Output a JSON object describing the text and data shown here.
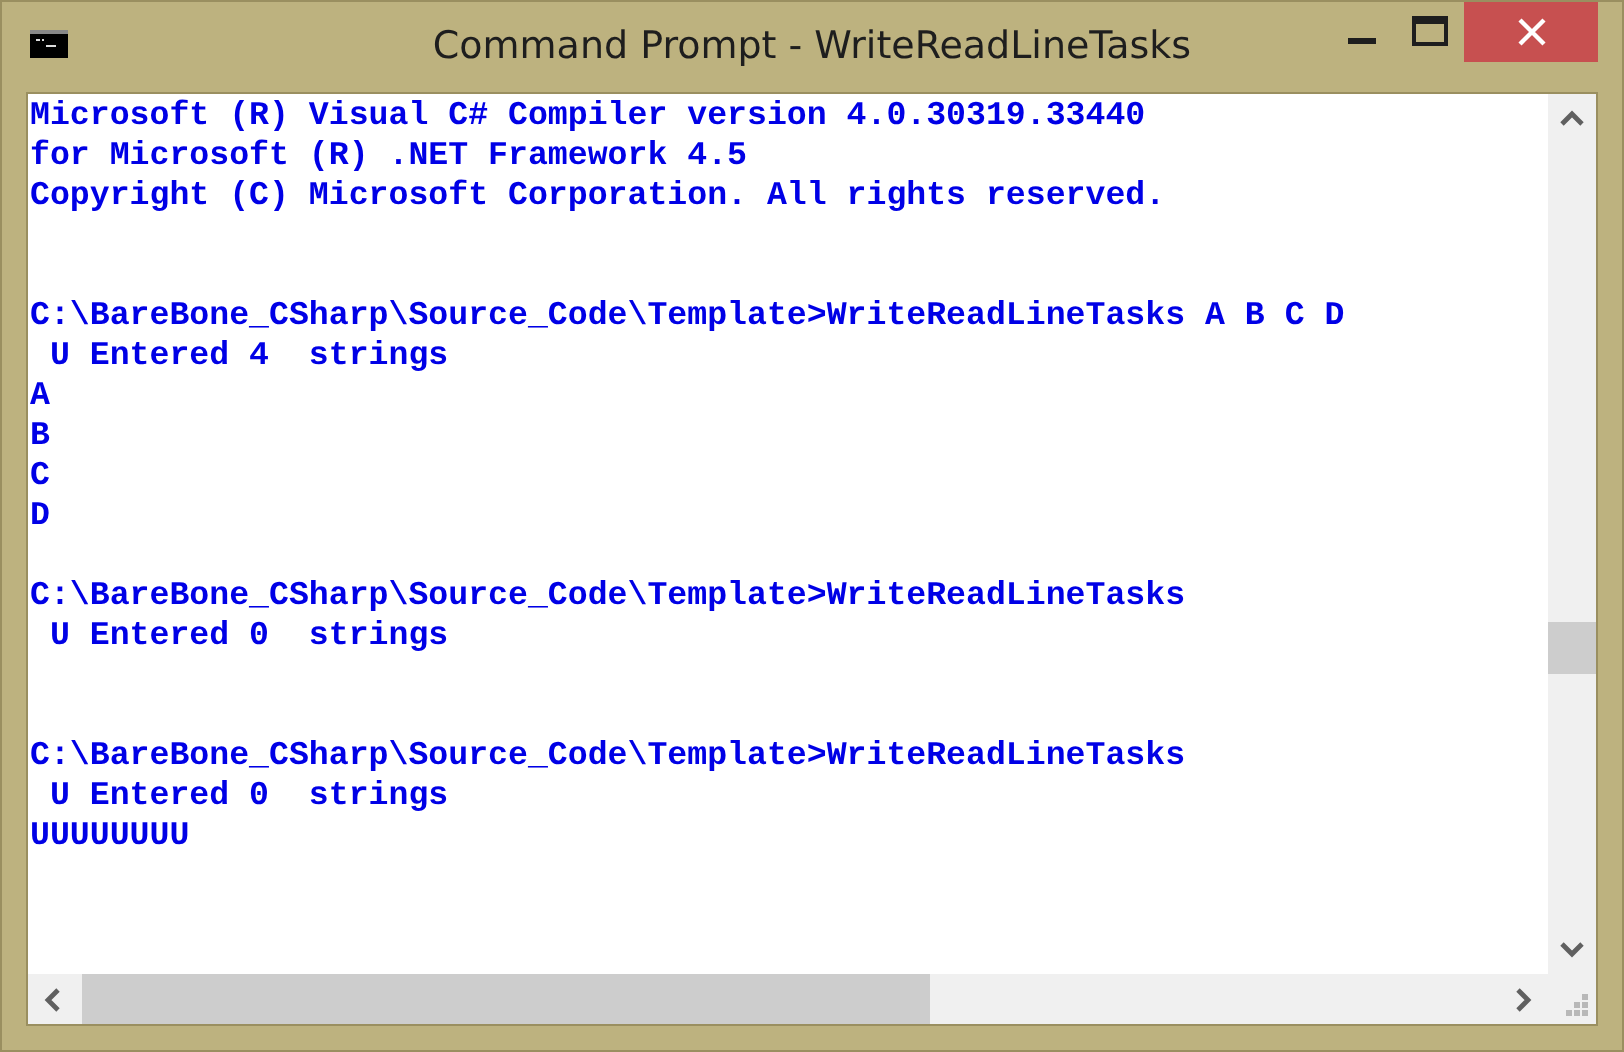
{
  "window": {
    "title": "Command Prompt - WriteReadLineTasks"
  },
  "console": {
    "lines": [
      {
        "kind": "text",
        "text": "Microsoft (R) Visual C# Compiler version 4.0.30319.33440"
      },
      {
        "kind": "text",
        "text": "for Microsoft (R) .NET Framework 4.5"
      },
      {
        "kind": "text",
        "text": "Copyright (C) Microsoft Corporation. All rights reserved."
      },
      {
        "kind": "blank"
      },
      {
        "kind": "blank"
      },
      {
        "kind": "text",
        "text": "C:\\BareBone_CSharp\\Source_Code\\Template>WriteReadLineTasks A B C D"
      },
      {
        "kind": "text",
        "text": " U Entered 4  strings"
      },
      {
        "kind": "text",
        "text": "A"
      },
      {
        "kind": "text",
        "text": "B"
      },
      {
        "kind": "text",
        "text": "C"
      },
      {
        "kind": "text",
        "text": "D"
      },
      {
        "kind": "blank"
      },
      {
        "kind": "text",
        "text": "C:\\BareBone_CSharp\\Source_Code\\Template>WriteReadLineTasks"
      },
      {
        "kind": "text",
        "text": " U Entered 0  strings"
      },
      {
        "kind": "blank"
      },
      {
        "kind": "blank"
      },
      {
        "kind": "text",
        "text": "C:\\BareBone_CSharp\\Source_Code\\Template>WriteReadLineTasks"
      },
      {
        "kind": "text",
        "text": " U Entered 0  strings"
      },
      {
        "kind": "text",
        "text": "UUUUUUUU"
      }
    ]
  }
}
